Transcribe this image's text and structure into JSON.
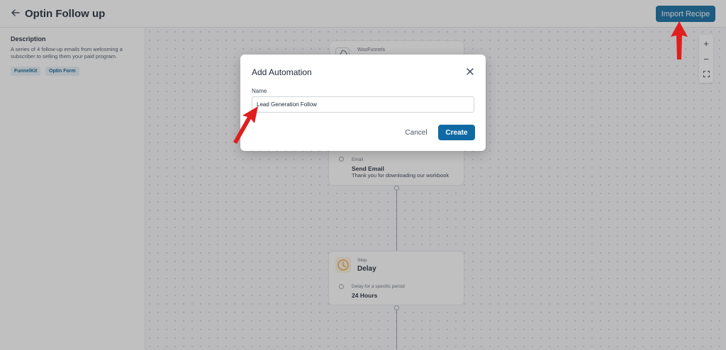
{
  "header": {
    "title": "Optin Follow up",
    "import_label": "Import Recipe",
    "back_icon": "arrow-left-icon"
  },
  "sidebar": {
    "description_title": "Description",
    "description_text": "A series of 4 follow-up emails from welcoming a subscriber to selling them your paid program.",
    "tags": [
      "FunnelKit",
      "Optin Form"
    ]
  },
  "canvas": {
    "zoom_controls": {
      "zoom_in": "+",
      "zoom_out": "−"
    },
    "trigger_node": {
      "brand": "WooFunnels"
    },
    "email_node": {
      "type_label": "Email",
      "action": "Send Email",
      "subject": "Thank you for downloading our workbook"
    },
    "delay_node": {
      "kind": "Step",
      "title": "Delay",
      "sub_label": "Delay for a specific period",
      "value": "24 Hours"
    }
  },
  "modal": {
    "title": "Add Automation",
    "name_label": "Name",
    "name_value": "Lead Generation Follow",
    "cancel_label": "Cancel",
    "create_label": "Create"
  },
  "colors": {
    "primary": "#0f6aa3",
    "annotation_arrow": "#e01e1e",
    "delay_icon": "#f2a94b"
  }
}
